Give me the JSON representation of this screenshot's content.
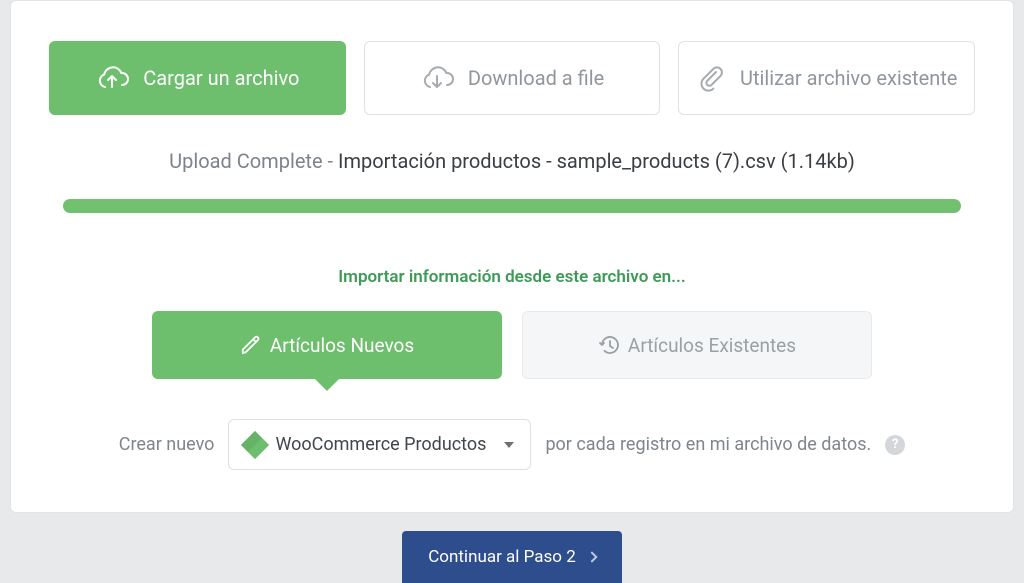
{
  "tabs": {
    "upload": "Cargar un archivo",
    "download": "Download a file",
    "existing": "Utilizar archivo existente"
  },
  "upload_status": {
    "prefix": "Upload Complete",
    "separator": " - ",
    "filename": "Importación productos - sample_products (7).csv",
    "size": "(1.14kb)"
  },
  "import_hint": "Importar información desde este archivo en...",
  "toggles": {
    "new_items": "Artículos Nuevos",
    "existing_items": "Artículos Existentes"
  },
  "create_line": {
    "prefix": "Crear nuevo",
    "select_value": "WooCommerce Productos",
    "suffix": "por cada registro en mi archivo de datos."
  },
  "help_glyph": "?",
  "continue_label": "Continuar al Paso 2"
}
